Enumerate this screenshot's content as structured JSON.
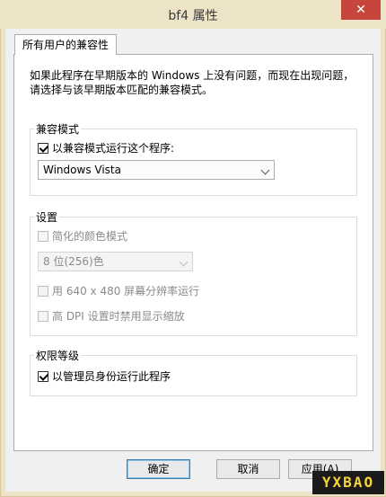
{
  "window": {
    "title": "bf4 属性",
    "close_glyph": "✕"
  },
  "tab": {
    "label": "所有用户的兼容性"
  },
  "intro": {
    "line1": "如果此程序在早期版本的 Windows 上没有问题，而现在出现问题，",
    "line2": "请选择与该早期版本匹配的兼容模式。"
  },
  "compat_group": {
    "label": "兼容模式",
    "checkbox_label": "以兼容模式运行这个程序:",
    "checkbox_checked": true,
    "select_value": "Windows Vista"
  },
  "settings_group": {
    "label": "设置",
    "reduced_color_label": "简化的颜色模式",
    "reduced_color_checked": false,
    "color_select_value": "8 位(256)色",
    "res_640_label": "用 640 x 480 屏幕分辨率运行",
    "res_640_checked": false,
    "high_dpi_label": "高 DPI 设置时禁用显示缩放",
    "high_dpi_checked": false
  },
  "privilege_group": {
    "label": "权限等级",
    "run_as_admin_label": "以管理员身份运行此程序",
    "run_as_admin_checked": true
  },
  "buttons": {
    "ok": "确定",
    "cancel": "取消",
    "apply": "应用(A)"
  },
  "watermark": {
    "text": "YXBAO"
  }
}
